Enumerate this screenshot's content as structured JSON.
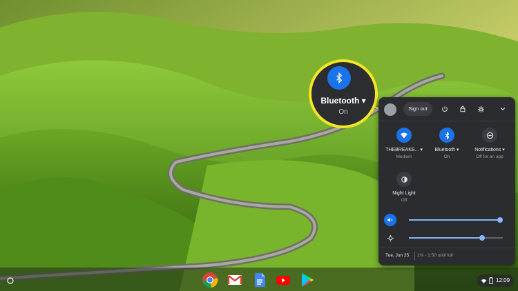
{
  "callout": {
    "label": "Bluetooth",
    "state": "On"
  },
  "panel": {
    "sign_out": "Sign out",
    "tiles": [
      {
        "name": "THEBREAKE...",
        "state": "Medium",
        "icon": "wifi-icon",
        "active": true
      },
      {
        "name": "Bluetooth",
        "state": "On",
        "icon": "bluetooth-icon",
        "active": true
      },
      {
        "name": "Notifications",
        "state": "Off for an app",
        "icon": "notifications-icon",
        "active": false
      },
      {
        "name": "Night Light",
        "state": "Off",
        "icon": "night-light-icon",
        "active": false
      }
    ],
    "volume_level": 0.97,
    "brightness_level": 0.78,
    "date": "Tue, Jun 25",
    "battery": "1% - 1:50 until full"
  },
  "shelf": {
    "apps": [
      "chrome-icon",
      "gmail-icon",
      "docs-icon",
      "youtube-icon",
      "play-store-icon"
    ],
    "time": "12:09"
  },
  "colors": {
    "accent": "#1a73e8",
    "callout_border": "#f5e623",
    "panel_bg": "#2b2c30"
  }
}
